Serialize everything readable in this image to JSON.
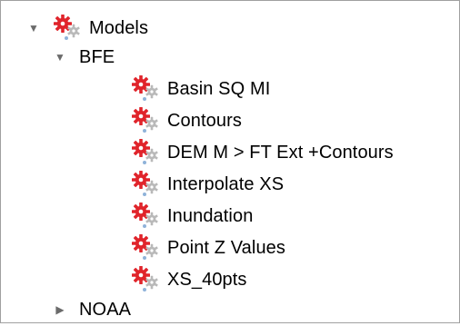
{
  "colors": {
    "gear_red": "#e0242b",
    "gear_gray": "#b9b9b9",
    "toggle": "#6b6b6b"
  },
  "tree": {
    "models": {
      "label": "Models",
      "icon": "model-gear-icon",
      "expanded": true
    },
    "bfe": {
      "label": "BFE",
      "expanded": true
    },
    "bfe_items": [
      {
        "label": "Basin SQ MI",
        "icon": "model-gear-icon"
      },
      {
        "label": "Contours",
        "icon": "model-gear-icon"
      },
      {
        "label": "DEM M > FT Ext +Contours",
        "icon": "model-gear-icon"
      },
      {
        "label": "Interpolate XS",
        "icon": "model-gear-icon"
      },
      {
        "label": "Inundation",
        "icon": "model-gear-icon"
      },
      {
        "label": "Point Z Values",
        "icon": "model-gear-icon"
      },
      {
        "label": "XS_40pts",
        "icon": "model-gear-icon"
      }
    ],
    "noaa": {
      "label": "NOAA",
      "expanded": false
    }
  }
}
